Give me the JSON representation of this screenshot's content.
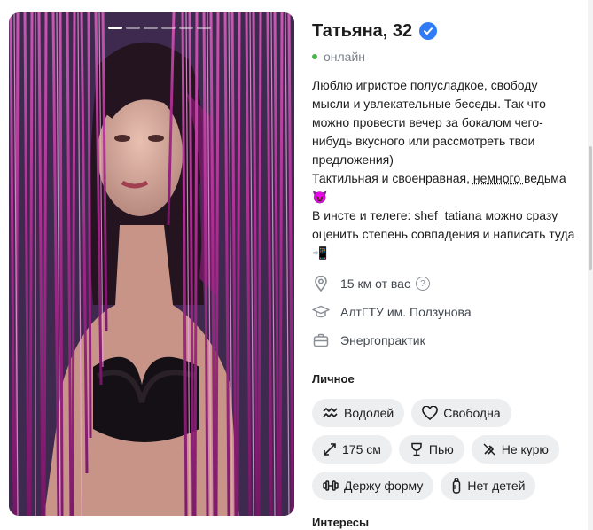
{
  "profile": {
    "name": "Татьяна, 32",
    "status": "онлайн",
    "bio": {
      "line1": "Люблю игристое полусладкое, свободу мысли и увлекательные беседы. Так что можно провести вечер за бокалом чего-нибудь вкусного или рассмотреть твои предложения)",
      "line2a": "Тактильная и своенравная, ",
      "line2u": "немного ",
      "line2b": "ведьма 😈",
      "line3": "В инсте и телеге: shef_tatiana можно сразу оценить степень совпадения и написать туда📲"
    }
  },
  "facts": {
    "distance": "15 км от вас",
    "university": "АлтГТУ им. Ползунова",
    "work": "Энергопрактик"
  },
  "personal": {
    "title": "Личное",
    "chips": {
      "zodiac": "Водолей",
      "relationship": "Свободна",
      "height": "175 см",
      "alcohol": "Пью",
      "smoking": "Не курю",
      "sport": "Держу форму",
      "children": "Нет детей"
    }
  },
  "interests_title": "Интересы",
  "photo": {
    "count": 6,
    "active": 0
  },
  "colors": {
    "accent": "#2f7cf6",
    "online": "#4bb34b",
    "chip_bg": "#edeef0"
  },
  "icons": [
    "verified-icon",
    "location-pin-icon",
    "help-circle-icon",
    "graduation-cap-icon",
    "briefcase-icon",
    "zodiac-wave-icon",
    "heart-icon",
    "resize-arrows-icon",
    "wine-glass-icon",
    "no-smoking-icon",
    "dumbbell-icon",
    "baby-bottle-icon"
  ]
}
